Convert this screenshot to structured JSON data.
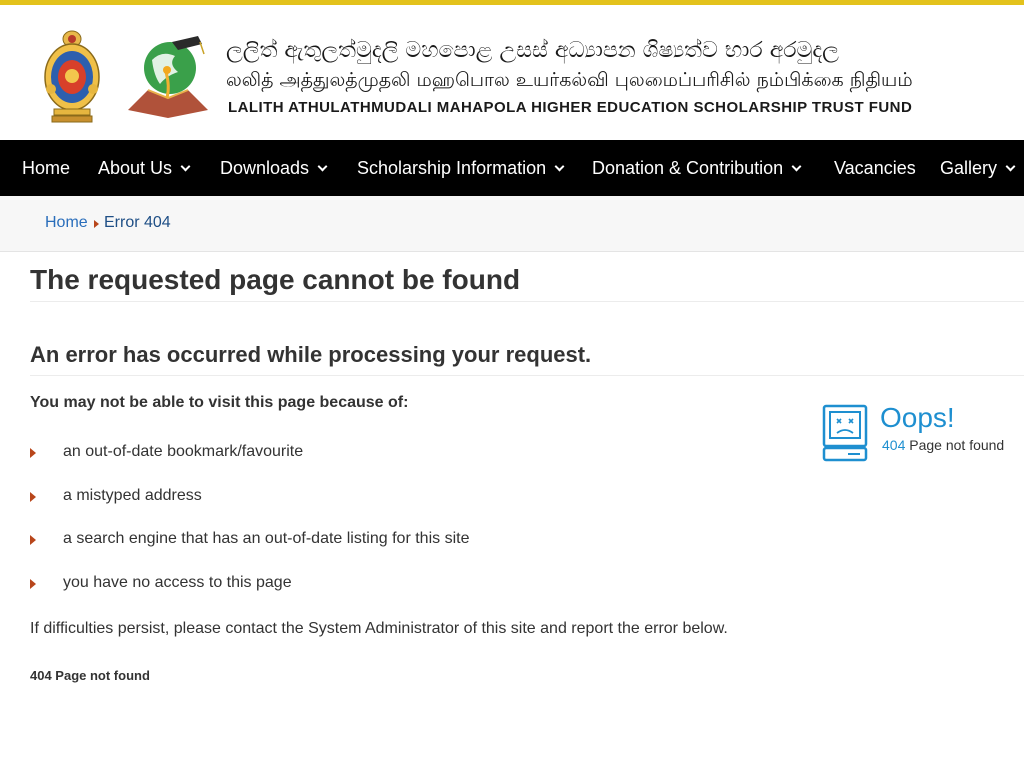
{
  "header": {
    "title_sinhala": "ලලිත් ඇතුලත්මුදලි මහපොළ උසස් අධ්‍යාපන ශිෂ්‍යත්ව භාර අරමුදල",
    "title_tamil": "லலித் அத்துலத்முதலி மஹபொல உயர்கல்வி புலமைப்பரிசில் நம்பிக்கை நிதியம்",
    "title_english": "LALITH ATHULATHMUDALI MAHAPOLA HIGHER EDUCATION SCHOLARSHIP TRUST FUND"
  },
  "nav": {
    "items": [
      {
        "label": "Home"
      },
      {
        "label": "About Us"
      },
      {
        "label": "Downloads"
      },
      {
        "label": "Scholarship Information"
      },
      {
        "label": "Donation & Contribution"
      },
      {
        "label": "Vacancies"
      },
      {
        "label": "Gallery"
      }
    ]
  },
  "breadcrumb": {
    "home": "Home",
    "current": "Error 404"
  },
  "main": {
    "heading": "The requested page cannot be found",
    "subheading": "An error has occurred while processing your request.",
    "lead": "You may not be able to visit this page because of:",
    "reasons": [
      "an out-of-date bookmark/favourite",
      "a mistyped address",
      "a search engine that has an out-of-date listing for this site",
      "you have no access to this page"
    ],
    "persist": "If difficulties persist, please contact the System Administrator of this site and report the error below.",
    "error_code": "404 Page not found"
  },
  "oops": {
    "title": "Oops!",
    "code": "404",
    "text": "Page not found"
  },
  "colors": {
    "accent_gold": "#e3c21c",
    "nav_bg": "#000000",
    "link_blue": "#2a6ebb",
    "bullet_red": "#b8461b",
    "oops_blue": "#1e8fd0"
  }
}
